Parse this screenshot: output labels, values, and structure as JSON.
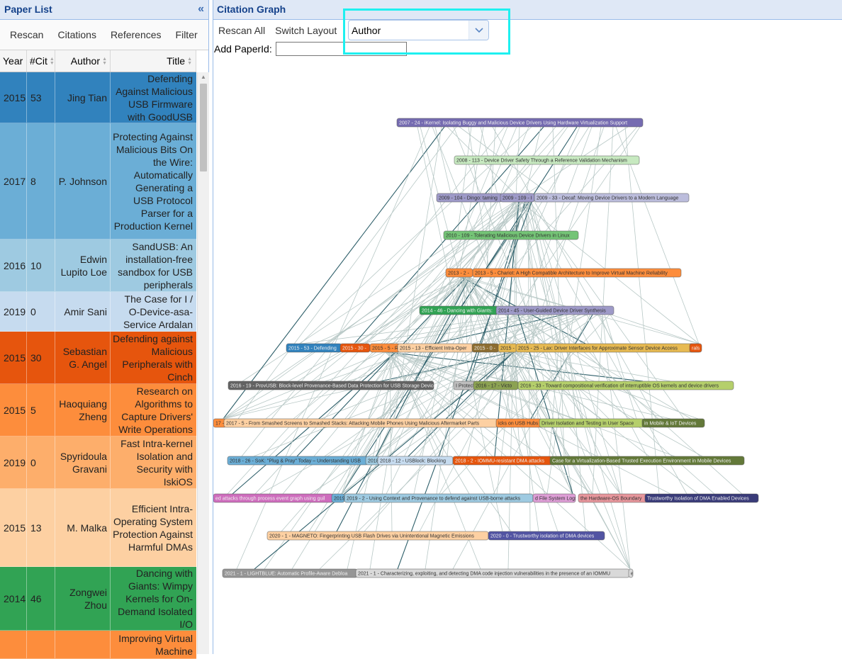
{
  "left_panel": {
    "title": "Paper List",
    "collapse_icon": "«",
    "toolbar": [
      "Rescan",
      "Citations",
      "References",
      "Filter"
    ],
    "columns": {
      "year": "Year",
      "citations": "#Cit",
      "author": "Author",
      "title": "Title"
    },
    "rows": [
      {
        "year": "2015",
        "cit": "53",
        "author": "Jing Tian",
        "title": "Defending Against Malicious USB Firmware with GoodUSB",
        "color": "#3182bd"
      },
      {
        "year": "2017",
        "cit": "8",
        "author": "P. Johnson",
        "title": "Protecting Against Malicious Bits On the Wire: Automatically Generating a USB Protocol Parser for a Production Kernel",
        "color": "#6baed6"
      },
      {
        "year": "2016",
        "cit": "10",
        "author": "Edwin Lupito Loe",
        "title": "SandUSB: An installation-free sandbox for USB peripherals",
        "color": "#9ecae1"
      },
      {
        "year": "2019",
        "cit": "0",
        "author": "Amir Sani",
        "title": "The Case for I / O-Device-asa-Service Ardalan",
        "color": "#c6dbef"
      },
      {
        "year": "2015",
        "cit": "30",
        "author": "Sebastian G. Angel",
        "title": "Defending against Malicious Peripherals with Cinch",
        "color": "#e6550d"
      },
      {
        "year": "2015",
        "cit": "5",
        "author": "Haoquiang Zheng",
        "title": "Research on Algorithms to Capture Drivers' Write Operations",
        "color": "#fd8d3c"
      },
      {
        "year": "2019",
        "cit": "0",
        "author": "Spyridoula Gravani",
        "title": "Fast Intra-kernel Isolation and Security with IskiOS",
        "color": "#fdae6b"
      },
      {
        "year": "2015",
        "cit": "13",
        "author": "M. Malka",
        "title": "Efficient Intra-Operating System Protection Against Harmful DMAs",
        "color": "#fdd0a2"
      },
      {
        "year": "2014",
        "cit": "46",
        "author": "Zongwei Zhou",
        "title": "Dancing with Giants: Wimpy Kernels for On-Demand Isolated I/O",
        "color": "#31a354"
      },
      {
        "year": "",
        "cit": "",
        "author": "",
        "title": "Improving Virtual Machine",
        "color": "#fd8d3c"
      }
    ]
  },
  "right_panel": {
    "title": "Citation Graph",
    "buttons": [
      "Rescan All",
      "Switch Layout"
    ],
    "layout_select": {
      "value": "Author"
    },
    "add_paper_label": "Add PaperId:",
    "add_paper_value": "",
    "nodes": [
      {
        "label": "2007 - 24 - iKernel: Isolating Buggy and Malicious Device Drivers Using Hardware Virtualization Support",
        "color": "#756bb1"
      },
      {
        "label": "2008 - 113 - Device Driver Safety Through a Reference Validation Mechanism",
        "color": "#c7e9c0"
      },
      {
        "label": "2009 - 104 - Dingo: taming",
        "color": "#9e9ac8"
      },
      {
        "label": "2009 - 109 - I",
        "color": "#9e9ac8"
      },
      {
        "label": "2009 - 33 - Decaf: Moving Device Drivers to a Modern Language",
        "color": "#bcbddc"
      },
      {
        "label": "2010 - 109 - Tolerating Malicious Device Drivers in Linux",
        "color": "#74c476"
      },
      {
        "label": "2013 - 2 -",
        "color": "#fd8d3c"
      },
      {
        "label": "2013 - 5 - Chariot: A High Compatible Architecture to Improve Virtual Machine Reliability",
        "color": "#fd8d3c"
      },
      {
        "label": "2014 - 46 - Dancing with Giants:",
        "color": "#31a354"
      },
      {
        "label": "2014 - 45 - User-Guided Device Driver Synthesis",
        "color": "#9e9ac8"
      },
      {
        "label": "2015 - 53 - Defending",
        "color": "#3182bd"
      },
      {
        "label": "2015 - 30 -",
        "color": "#e6550d"
      },
      {
        "label": "2015 - 5 - R",
        "color": "#fd8d3c"
      },
      {
        "label": "2015 - 13 - Efficient Intra-Oper",
        "color": "#fdd0a2"
      },
      {
        "label": "2015 - 0 -",
        "color": "#8c6d31"
      },
      {
        "label": "2015 -",
        "color": "#e7ba52"
      },
      {
        "label": "2015 - 25 - Lax: Driver Interfaces for Approximate Sensor Device Access",
        "color": "#e7ba52"
      },
      {
        "label": "rals",
        "color": "#e6550d"
      },
      {
        "label": "2016 - 19 - ProvUSB: Block-level Provenance-Based Data Protection for USB Storage Devices",
        "color": "#636363"
      },
      {
        "label": "I Protect",
        "color": "#bdbdbd"
      },
      {
        "label": "2016 - 17 - Victo",
        "color": "#8ca252"
      },
      {
        "label": "2016 - 33 - Toward compositional verification of interruptible OS kernels and device drivers",
        "color": "#b5cf6b"
      },
      {
        "label": "17 - 3",
        "color": "#fd8d3c"
      },
      {
        "label": "2017 - 5 - From Smashed Screens to Smashed Stacks: Attacking Mobile Phones Using Malicious Aftermarket Parts",
        "color": "#fdd0a2"
      },
      {
        "label": "icks on USB Hubs",
        "color": "#fd8d3c"
      },
      {
        "label": "Driver Isolation and Testing in User Space",
        "color": "#b5cf6b"
      },
      {
        "label": "in Mobile & IoT Devices",
        "color": "#637939"
      },
      {
        "label": "2018 - 26 - SoK: \"Plug & Pray\" Today – Understanding USB",
        "color": "#6baed6"
      },
      {
        "label": "2018",
        "color": "#9ecae1"
      },
      {
        "label": "2018 - 12 - USBlock: Blocking",
        "color": "#c6dbef"
      },
      {
        "label": "2018 - 2 - IOMMU-resistant DMA attacks",
        "color": "#e6550d"
      },
      {
        "label": "Case for a Virtualization-Based Trusted Execution Environment in Mobile Devices",
        "color": "#637939"
      },
      {
        "label": "ed attacks through process event graph using guil",
        "color": "#ce6dbd"
      },
      {
        "label": "2019",
        "color": "#6baed6"
      },
      {
        "label": "2019 - 2 - Using Context and Provenance to defend against USB-borne attacks",
        "color": "#9ecae1"
      },
      {
        "label": "d File System Logs",
        "color": "#de9ed6"
      },
      {
        "label": "the Hardware-OS Boundary",
        "color": "#e7969c"
      },
      {
        "label": "Trustworthy Isolation of DMA Enabled Devices",
        "color": "#393b79"
      },
      {
        "label": "2020 - 1 - MAGNETO: Fingerprinting USB Flash Drives via Unintentional Magnetic Emissions",
        "color": "#fdd0a2"
      },
      {
        "label": "2020 - 0 - Trustworthy isolation of DMA devices",
        "color": "#5254a3"
      },
      {
        "label": "2021 - 1 - LIGHTBLUE: Automatic Profile-Aware Debloa",
        "color": "#969696"
      },
      {
        "label": "2021 - 1 - Characterizing, exploiting, and detecting DMA code injection vulnerabilities in the presence of an IOMMU",
        "color": "#d9d9d9"
      },
      {
        "label": "e",
        "color": "#d9d9d9"
      }
    ]
  }
}
